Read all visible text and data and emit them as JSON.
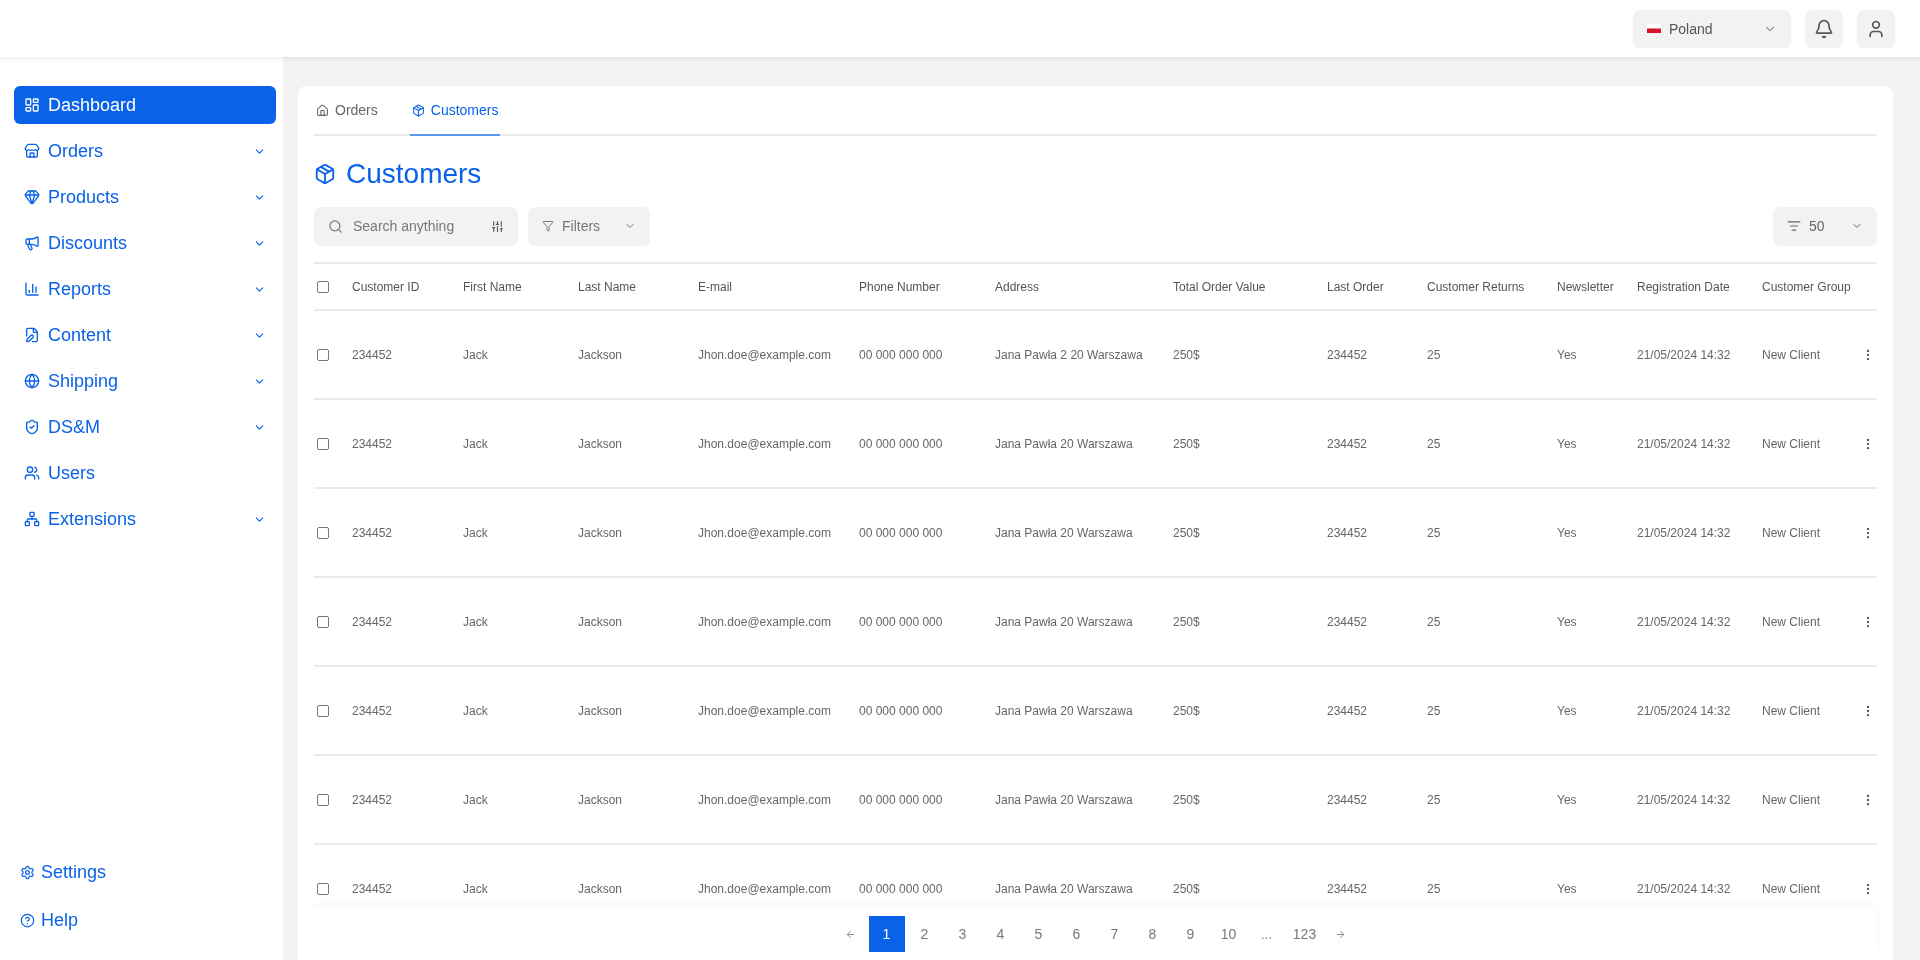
{
  "header": {
    "country": {
      "label": "Poland"
    }
  },
  "sidebar": {
    "items": [
      {
        "label": "Dashboard",
        "kind": "link",
        "selected": true
      },
      {
        "label": "Orders",
        "kind": "group",
        "selected": false
      },
      {
        "label": "Products",
        "kind": "group",
        "selected": false
      },
      {
        "label": "Discounts",
        "kind": "group",
        "selected": false
      },
      {
        "label": "Reports",
        "kind": "group",
        "selected": false
      },
      {
        "label": "Content",
        "kind": "group",
        "selected": false
      },
      {
        "label": "Shipping",
        "kind": "group",
        "selected": false
      },
      {
        "label": "DS&M",
        "kind": "group",
        "selected": false
      },
      {
        "label": "Users",
        "kind": "link",
        "selected": false
      },
      {
        "label": "Extensions",
        "kind": "group",
        "selected": false
      }
    ],
    "footer": [
      {
        "label": "Settings"
      },
      {
        "label": "Help"
      }
    ]
  },
  "tabs": [
    {
      "label": "Orders",
      "selected": false
    },
    {
      "label": "Customers",
      "selected": true
    }
  ],
  "page_title": "Customers",
  "toolbar": {
    "search": {
      "placeholder": "Search anything"
    },
    "filters": {
      "label": "Filters"
    },
    "page_size": {
      "value": "50"
    }
  },
  "table": {
    "all_checked": false,
    "columns": [
      "Customer ID",
      "First Name",
      "Last Name",
      "E-mail",
      "Phone Number",
      "Address",
      "Total Order Value",
      "Last Order",
      "Customer Returns",
      "Newsletter",
      "Registration Date",
      "Customer Group"
    ],
    "rows": [
      {
        "checked": false,
        "cells": [
          "234452",
          "Jack",
          "Jackson",
          "Jhon.doe@example.com",
          "00 000 000 000",
          "Jana Pawła 2 20 Warszawa",
          "250$",
          "234452",
          "25",
          "Yes",
          "21/05/2024 14:32",
          "New Client"
        ]
      },
      {
        "checked": false,
        "cells": [
          "234452",
          "Jack",
          "Jackson",
          "Jhon.doe@example.com",
          "00 000 000 000",
          "Jana Pawła 20 Warszawa",
          "250$",
          "234452",
          "25",
          "Yes",
          "21/05/2024 14:32",
          "New Client"
        ]
      },
      {
        "checked": false,
        "cells": [
          "234452",
          "Jack",
          "Jackson",
          "Jhon.doe@example.com",
          "00 000 000 000",
          "Jana Pawła 20 Warszawa",
          "250$",
          "234452",
          "25",
          "Yes",
          "21/05/2024 14:32",
          "New Client"
        ]
      },
      {
        "checked": false,
        "cells": [
          "234452",
          "Jack",
          "Jackson",
          "Jhon.doe@example.com",
          "00 000 000 000",
          "Jana Pawła 20 Warszawa",
          "250$",
          "234452",
          "25",
          "Yes",
          "21/05/2024 14:32",
          "New Client"
        ]
      },
      {
        "checked": false,
        "cells": [
          "234452",
          "Jack",
          "Jackson",
          "Jhon.doe@example.com",
          "00 000 000 000",
          "Jana Pawła 20 Warszawa",
          "250$",
          "234452",
          "25",
          "Yes",
          "21/05/2024 14:32",
          "New Client"
        ]
      },
      {
        "checked": false,
        "cells": [
          "234452",
          "Jack",
          "Jackson",
          "Jhon.doe@example.com",
          "00 000 000 000",
          "Jana Pawła 20 Warszawa",
          "250$",
          "234452",
          "25",
          "Yes",
          "21/05/2024 14:32",
          "New Client"
        ]
      },
      {
        "checked": false,
        "cells": [
          "234452",
          "Jack",
          "Jackson",
          "Jhon.doe@example.com",
          "00 000 000 000",
          "Jana Pawła 20 Warszawa",
          "250$",
          "234452",
          "25",
          "Yes",
          "21/05/2024 14:32",
          "New Client"
        ]
      }
    ]
  },
  "pagination": {
    "pages": [
      {
        "label": "1",
        "kind": "page",
        "selected": true
      },
      {
        "label": "2",
        "kind": "page",
        "selected": false
      },
      {
        "label": "3",
        "kind": "page",
        "selected": false
      },
      {
        "label": "4",
        "kind": "page",
        "selected": false
      },
      {
        "label": "5",
        "kind": "page",
        "selected": false
      },
      {
        "label": "6",
        "kind": "page",
        "selected": false
      },
      {
        "label": "7",
        "kind": "page",
        "selected": false
      },
      {
        "label": "8",
        "kind": "page",
        "selected": false
      },
      {
        "label": "9",
        "kind": "page",
        "selected": false
      },
      {
        "label": "10",
        "kind": "page",
        "selected": false
      },
      {
        "label": "...",
        "kind": "gap"
      },
      {
        "label": "123",
        "kind": "page",
        "selected": false
      }
    ]
  }
}
